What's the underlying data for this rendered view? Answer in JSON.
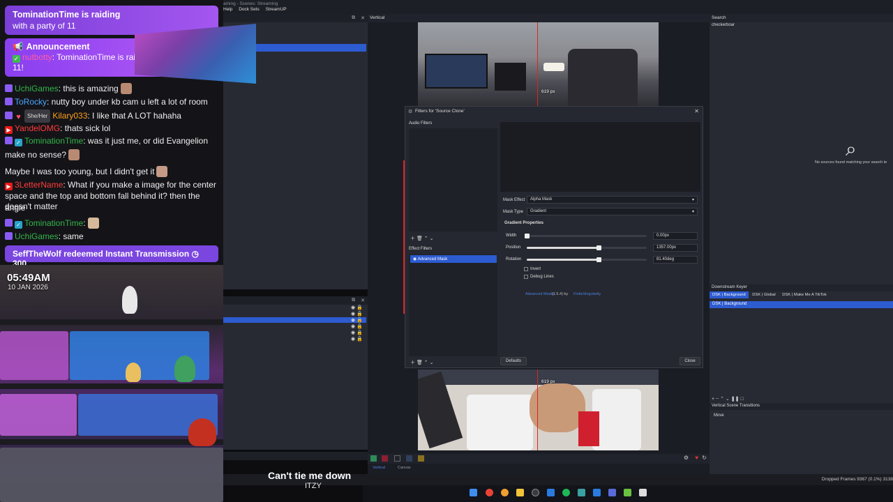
{
  "chat": {
    "raid": {
      "line1": "TominationTime is raiding",
      "line2": "with a party of 11"
    },
    "announcement": {
      "title": "Announcement",
      "bot": "nutbotty",
      "text": ": TominationTime is raiding with a party of 11!"
    },
    "messages": [
      {
        "user": "UchiGames",
        "text": ": this is amazing"
      },
      {
        "user": "ToRocky",
        "text": ": nutty boy under kb cam u left a lot of room"
      },
      {
        "pronoun": "She/Her",
        "user": "Kilary033",
        "text": ": I like that A LOT hahaha"
      },
      {
        "user": "YandelOMG",
        "text": ": thats sick lol"
      },
      {
        "user": "TominationTime",
        "text": ": was it just me, or did Evangelion"
      },
      {
        "text": "make no sense?"
      },
      {
        "text": "Maybe I was too young, but I didn't get it"
      },
      {
        "user": "3LetterName",
        "text": ": What if you make a image for the center"
      },
      {
        "text": "space and the top and bottom fall behind it? then the angle"
      },
      {
        "text": "doesn't matter"
      },
      {
        "user": "TominationTime",
        "text": ":"
      },
      {
        "user": "UchiGames",
        "text": ": same"
      }
    ],
    "redemption": {
      "text": "SeffTheWolf redeemed Instant Transmission",
      "cost": "300"
    }
  },
  "cam": {
    "time": "05:49AM",
    "date": "10 JAN 2026"
  },
  "obs": {
    "window_title": "aming - Scenes: Streaming",
    "menu": [
      "Help",
      "Dock Sets",
      "StreamUP"
    ],
    "vertical_title": "Vertical",
    "preview_px_top": "619 px",
    "preview_px_bottom": "619 px",
    "bottom_tabs": [
      "Vertical",
      "Canvas"
    ],
    "status": "Dropped Frames 9367 (0.1%)",
    "status_extra": "3138"
  },
  "filters_dialog": {
    "title": "Filters for 'Source Clone'",
    "audio_filters": "Audio Filters",
    "effect_filters": "Effect Filters",
    "selected_filter": "Advanced Mask",
    "mask_effect_label": "Mask Effect",
    "mask_effect_value": "Alpha Mask",
    "mask_type_label": "Mask Type",
    "mask_type_value": "Gradient",
    "gradient_props": "Gradient Properties",
    "width_label": "Width",
    "width_value": "0.00px",
    "width_level": 0.0,
    "position_label": "Position",
    "position_value": "1357.00px",
    "position_level": 0.6,
    "rotation_label": "Rotation",
    "rotation_value": "81.40deg",
    "rotation_level": 0.6,
    "invert_label": "Invert",
    "debug_label": "Debug Lines",
    "credit_link": "Advanced Masks",
    "credit_version": "(1.5.4) by",
    "credit_author": "FiniteSingularity",
    "defaults_btn": "Defaults",
    "close_btn": "Close"
  },
  "right_dock": {
    "search_title": "Search",
    "search_value": "checkerboar",
    "no_sources": "No sources found matching your search te",
    "dsk_title": "Downstream Keyer",
    "dsk_tabs": [
      "DSK | Background",
      "DSK | Global",
      "DSK | Make Me A TikTok"
    ],
    "dsk_row": "DSK | Background",
    "transitions_title": "Vertical Scene Transitions",
    "transition_value": "Move"
  },
  "now_playing": {
    "title": "Can't tie me down",
    "artist": "ITZY"
  },
  "colors": {
    "accent": "#2d5bd0",
    "raid": "#8a3ff0",
    "redline": "#e02424"
  }
}
